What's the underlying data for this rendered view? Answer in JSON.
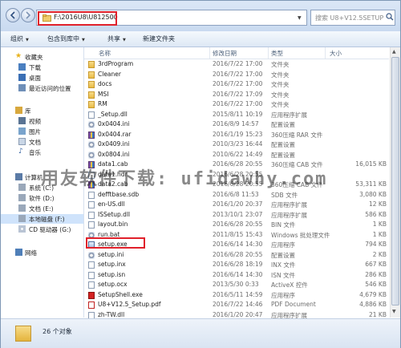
{
  "address": {
    "path": "F:\\2016U8\\U812500",
    "search_placeholder": "搜索 U8+V12.5SETUP"
  },
  "toolbar": {
    "organize": "组织",
    "include_library": "包含到库中",
    "share": "共享",
    "new_folder": "新建文件夹"
  },
  "nav": {
    "favorites": "收藏夹",
    "downloads": "下载",
    "desktop": "桌面",
    "recent": "最近访问的位置",
    "libraries": "库",
    "videos": "视频",
    "pictures": "图片",
    "documents": "文档",
    "music": "音乐",
    "computer": "计算机",
    "drive_c": "系统 (C:)",
    "drive_d": "软件 (D:)",
    "drive_e": "文档 (E:)",
    "drive_f": "本地磁盘 (F:)",
    "drive_g": "CD 驱动器 (G:)",
    "network": "网络"
  },
  "columns": {
    "name": "名称",
    "date": "修改日期",
    "type": "类型",
    "size": "大小"
  },
  "files": [
    {
      "name": "3rdProgram",
      "date": "2016/7/22 17:00",
      "type": "文件夹",
      "size": "",
      "icon": "folder"
    },
    {
      "name": "Cleaner",
      "date": "2016/7/22 17:00",
      "type": "文件夹",
      "size": "",
      "icon": "folder"
    },
    {
      "name": "docs",
      "date": "2016/7/22 17:00",
      "type": "文件夹",
      "size": "",
      "icon": "folder"
    },
    {
      "name": "MSI",
      "date": "2016/7/22 17:09",
      "type": "文件夹",
      "size": "",
      "icon": "folder"
    },
    {
      "name": "RM",
      "date": "2016/7/22 17:00",
      "type": "文件夹",
      "size": "",
      "icon": "folder"
    },
    {
      "name": "_Setup.dll",
      "date": "2015/8/11 10:19",
      "type": "应用程序扩展",
      "size": "",
      "icon": "file"
    },
    {
      "name": "0x0404.ini",
      "date": "2016/8/9 14:57",
      "type": "配置设置",
      "size": "",
      "icon": "gear"
    },
    {
      "name": "0x0404.rar",
      "date": "2016/1/19 15:23",
      "type": "360压缩 RAR 文件",
      "size": "",
      "icon": "zip"
    },
    {
      "name": "0x0409.ini",
      "date": "2010/3/23 16:44",
      "type": "配置设置",
      "size": "",
      "icon": "gear"
    },
    {
      "name": "0x0804.ini",
      "date": "2010/6/22 14:49",
      "type": "配置设置",
      "size": "",
      "icon": "gear"
    },
    {
      "name": "data1.cab",
      "date": "2016/6/28 20:55",
      "type": "360压缩 CAB 文件",
      "size": "16,015 KB",
      "icon": "zip"
    },
    {
      "name": "data1.hdr",
      "date": "2016/6/28 20:55",
      "type": "",
      "size": "",
      "icon": "file"
    },
    {
      "name": "data2.cab",
      "date": "2016/6/28 20:55",
      "type": "360压缩 CAB 文件",
      "size": "53,311 KB",
      "icon": "zip"
    },
    {
      "name": "defftbase.sdb",
      "date": "2016/6/8 11:53",
      "type": "SDB 文件",
      "size": "3,080 KB",
      "icon": "file"
    },
    {
      "name": "en-US.dll",
      "date": "2016/1/20 20:37",
      "type": "应用程序扩展",
      "size": "12 KB",
      "icon": "file"
    },
    {
      "name": "ISSetup.dll",
      "date": "2013/10/1 23:07",
      "type": "应用程序扩展",
      "size": "586 KB",
      "icon": "file"
    },
    {
      "name": "layout.bin",
      "date": "2016/6/28 20:55",
      "type": "BIN 文件",
      "size": "1 KB",
      "icon": "file"
    },
    {
      "name": "run.bat",
      "date": "2011/8/15 15:43",
      "type": "Windows 批处理文件",
      "size": "1 KB",
      "icon": "gear"
    },
    {
      "name": "setup.exe",
      "date": "2016/6/14 14:30",
      "type": "应用程序",
      "size": "794 KB",
      "icon": "exe"
    },
    {
      "name": "setup.ini",
      "date": "2016/6/28 20:55",
      "type": "配置设置",
      "size": "2 KB",
      "icon": "gear"
    },
    {
      "name": "setup.inx",
      "date": "2016/6/28 18:19",
      "type": "INX 文件",
      "size": "667 KB",
      "icon": "file"
    },
    {
      "name": "setup.isn",
      "date": "2016/6/14 14:30",
      "type": "ISN 文件",
      "size": "286 KB",
      "icon": "file"
    },
    {
      "name": "setup.ocx",
      "date": "2013/5/30 0:33",
      "type": "ActiveX 控件",
      "size": "546 KB",
      "icon": "file"
    },
    {
      "name": "SetupShell.exe",
      "date": "2016/5/11 14:59",
      "type": "应用程序",
      "size": "4,679 KB",
      "icon": "red"
    },
    {
      "name": "U8+V12.5_Setup.pdf",
      "date": "2016/7/22 14:46",
      "type": "PDF Document",
      "size": "4,886 KB",
      "icon": "pdf"
    },
    {
      "name": "zh-TW.dll",
      "date": "2016/1/20 20:47",
      "type": "应用程序扩展",
      "size": "21 KB",
      "icon": "file"
    }
  ],
  "status": {
    "count_text": "26 个对象"
  },
  "watermark": {
    "text": "用友软件下载: ufidawhy.com"
  }
}
